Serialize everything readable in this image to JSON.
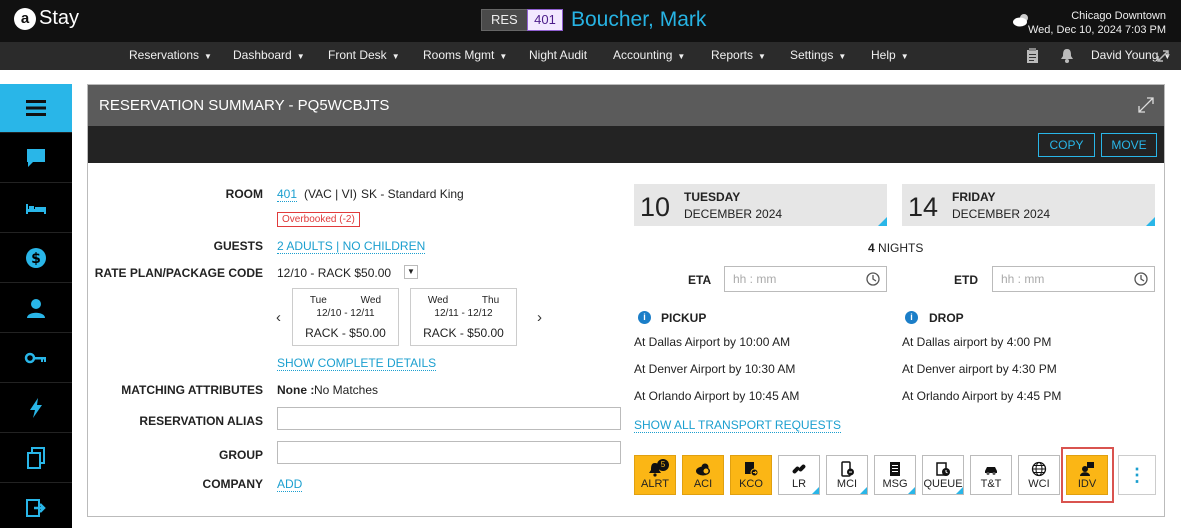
{
  "header": {
    "logo_letter": "a",
    "logo_text": "Stay",
    "res_label": "RES",
    "room_number": "401",
    "guest_name": "Boucher, Mark",
    "location": "Chicago Downtown",
    "datetime": "Wed, Dec 10, 2024 7:03 PM",
    "user": "David Young"
  },
  "menu": [
    "Reservations",
    "Dashboard",
    "Front Desk",
    "Rooms Mgmt",
    "Night Audit",
    "Accounting",
    "Reports",
    "Settings",
    "Help"
  ],
  "sidebar": [
    "menu",
    "messages",
    "rooms",
    "billing",
    "guest",
    "keys",
    "quick-actions",
    "documents",
    "checkout"
  ],
  "panel": {
    "title": "RESERVATION SUMMARY - PQ5WCBJTS",
    "copy_label": "COPY",
    "move_label": "MOVE"
  },
  "reservation": {
    "room_label": "ROOM",
    "room_number": "401",
    "room_status": "(VAC | VI)",
    "room_type": "SK - Standard King",
    "overbooked": "Overbooked (-2)",
    "guests_label": "GUESTS",
    "guests_value": "2 ADULTS | NO CHILDREN",
    "rate_label": "RATE PLAN/PACKAGE CODE",
    "rate_value": "12/10 - RACK $50.00",
    "rate_cards": [
      {
        "day1": "Tue",
        "day2": "Wed",
        "dates": "12/10  -  12/11",
        "price": "RACK - $50.00"
      },
      {
        "day1": "Wed",
        "day2": "Thu",
        "dates": "12/11  -  12/12",
        "price": "RACK - $50.00"
      }
    ],
    "show_details": "SHOW COMPLETE DETAILS",
    "matching_label": "MATCHING ATTRIBUTES",
    "matching_none": "None :",
    "matching_value": "No Matches",
    "alias_label": "RESERVATION ALIAS",
    "group_label": "GROUP",
    "company_label": "COMPANY",
    "company_add": "ADD"
  },
  "stay": {
    "arrival": {
      "day_num": "10",
      "weekday": "TUESDAY",
      "month": "DECEMBER 2024"
    },
    "departure": {
      "day_num": "14",
      "weekday": "FRIDAY",
      "month": "DECEMBER 2024"
    },
    "nights_count": "4",
    "nights_label": "NIGHTS",
    "eta_label": "ETA",
    "etd_label": "ETD",
    "time_placeholder": "hh : mm"
  },
  "transport": {
    "pickup_label": "PICKUP",
    "drop_label": "DROP",
    "pickups": [
      "At Dallas Airport by 10:00 AM",
      "At Denver Airport by 10:30 AM",
      "At Orlando Airport by 10:45 AM"
    ],
    "drops": [
      "At Dallas airport by 4:00 PM",
      "At Denver airport by 4:30 PM",
      "At Orlando Airport by 4:45 PM"
    ],
    "show_all": "SHOW ALL TRANSPORT REQUESTS"
  },
  "actions": [
    {
      "label": "ALRT",
      "icon": "bell-icon",
      "active": true,
      "count": "5"
    },
    {
      "label": "ACI",
      "icon": "cloud-checkin-icon",
      "active": true
    },
    {
      "label": "KCO",
      "icon": "checkout-doc-icon",
      "active": true
    },
    {
      "label": "LR",
      "icon": "link-icon",
      "active": false
    },
    {
      "label": "MCI",
      "icon": "mobile-checkin-icon",
      "active": false
    },
    {
      "label": "MSG",
      "icon": "message-doc-icon",
      "active": false
    },
    {
      "label": "QUEUE",
      "icon": "queue-icon",
      "active": false
    },
    {
      "label": "T&T",
      "icon": "car-icon",
      "active": false
    },
    {
      "label": "WCI",
      "icon": "globe-icon",
      "active": false
    },
    {
      "label": "IDV",
      "icon": "id-verify-icon",
      "active": true
    }
  ],
  "colors": {
    "accent": "#29b6e8",
    "orange": "#fbb615",
    "highlight": "#d9534f",
    "overbooked": "#e03b3b"
  }
}
